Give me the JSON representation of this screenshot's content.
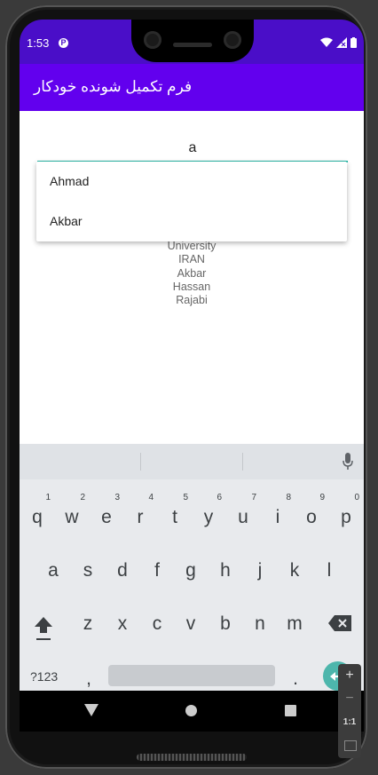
{
  "status_bar": {
    "time": "1:53"
  },
  "app_bar": {
    "title": "فرم تکمیل شونده خودکار"
  },
  "search": {
    "value": "a"
  },
  "suggestions": [
    "Ahmad",
    "Akbar"
  ],
  "list_items": [
    "University",
    "IRAN",
    "Akbar",
    "Hassan",
    "Rajabi"
  ],
  "keyboard": {
    "row1": [
      {
        "k": "q",
        "n": "1"
      },
      {
        "k": "w",
        "n": "2"
      },
      {
        "k": "e",
        "n": "3"
      },
      {
        "k": "r",
        "n": "4"
      },
      {
        "k": "t",
        "n": "5"
      },
      {
        "k": "y",
        "n": "6"
      },
      {
        "k": "u",
        "n": "7"
      },
      {
        "k": "i",
        "n": "8"
      },
      {
        "k": "o",
        "n": "9"
      },
      {
        "k": "p",
        "n": "0"
      }
    ],
    "row2": [
      "a",
      "s",
      "d",
      "f",
      "g",
      "h",
      "j",
      "k",
      "l"
    ],
    "row3": [
      "z",
      "x",
      "c",
      "v",
      "b",
      "n",
      "m"
    ],
    "symbols_label": "?123",
    "comma": ",",
    "period": "."
  },
  "emulator_panel": {
    "plus": "+",
    "minus": "−",
    "ratio": "1:1"
  },
  "colors": {
    "status_bar": "#4a0ec8",
    "app_bar": "#6200ee",
    "accent": "#28b8a8"
  }
}
